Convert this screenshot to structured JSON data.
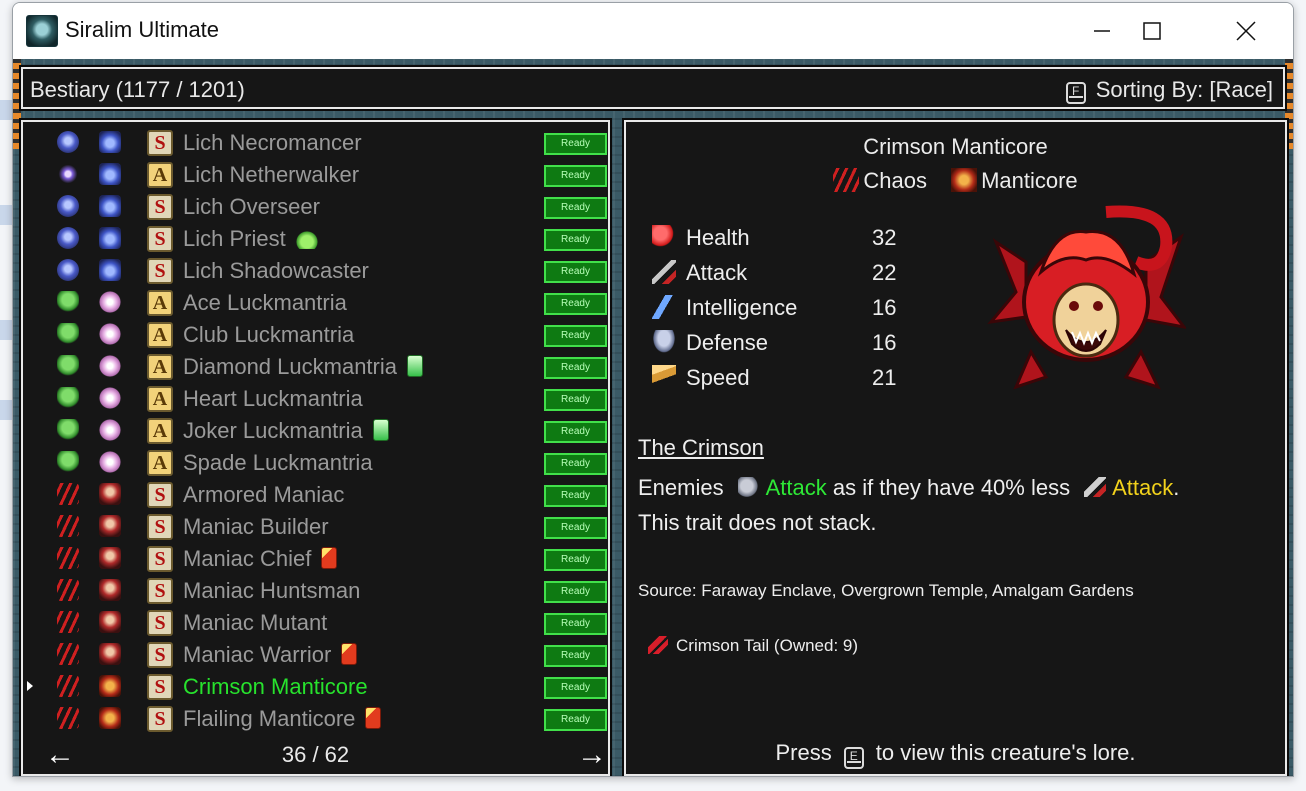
{
  "window": {
    "title": "Siralim Ultimate",
    "controls": [
      "minimize",
      "maximize",
      "close"
    ]
  },
  "header": {
    "title": "Bestiary (1177 / 1201)",
    "sort_key": "F",
    "sort_label": "Sorting By: [Race]"
  },
  "list": {
    "rows": [
      {
        "race": "lich",
        "family": "lich",
        "kind": "S",
        "name": "Lich Necromancer",
        "badge": "",
        "status": "Ready"
      },
      {
        "race": "spark",
        "family": "lich",
        "kind": "A",
        "name": "Lich Netherwalker",
        "badge": "",
        "status": "Ready"
      },
      {
        "race": "lich",
        "family": "lich",
        "kind": "S",
        "name": "Lich Overseer",
        "badge": "",
        "status": "Ready"
      },
      {
        "race": "lich",
        "family": "lich",
        "kind": "S",
        "name": "Lich Priest",
        "badge": "slime",
        "status": "Ready"
      },
      {
        "race": "lich",
        "family": "lich",
        "kind": "S",
        "name": "Lich Shadowcaster",
        "badge": "",
        "status": "Ready"
      },
      {
        "race": "tree",
        "family": "mantria",
        "kind": "A",
        "name": "Ace Luckmantria",
        "badge": "",
        "status": "Ready"
      },
      {
        "race": "tree",
        "family": "mantria",
        "kind": "A",
        "name": "Club Luckmantria",
        "badge": "",
        "status": "Ready"
      },
      {
        "race": "tree",
        "family": "mantria",
        "kind": "A",
        "name": "Diamond Luckmantria",
        "badge": "gem",
        "status": "Ready"
      },
      {
        "race": "tree",
        "family": "mantria",
        "kind": "A",
        "name": "Heart Luckmantria",
        "badge": "",
        "status": "Ready"
      },
      {
        "race": "tree",
        "family": "mantria",
        "kind": "A",
        "name": "Joker Luckmantria",
        "badge": "gem",
        "status": "Ready"
      },
      {
        "race": "tree",
        "family": "mantria",
        "kind": "A",
        "name": "Spade Luckmantria",
        "badge": "",
        "status": "Ready"
      },
      {
        "race": "chaos",
        "family": "maniac",
        "kind": "S",
        "name": "Armored Maniac",
        "badge": "",
        "status": "Ready"
      },
      {
        "race": "chaos",
        "family": "maniac",
        "kind": "S",
        "name": "Maniac Builder",
        "badge": "",
        "status": "Ready"
      },
      {
        "race": "chaos",
        "family": "maniac",
        "kind": "S",
        "name": "Maniac Chief",
        "badge": "card",
        "status": "Ready"
      },
      {
        "race": "chaos",
        "family": "maniac",
        "kind": "S",
        "name": "Maniac Huntsman",
        "badge": "",
        "status": "Ready"
      },
      {
        "race": "chaos",
        "family": "maniac",
        "kind": "S",
        "name": "Maniac Mutant",
        "badge": "",
        "status": "Ready"
      },
      {
        "race": "chaos",
        "family": "maniac",
        "kind": "S",
        "name": "Maniac Warrior",
        "badge": "card",
        "status": "Ready"
      },
      {
        "race": "chaos",
        "family": "manticore",
        "kind": "S",
        "name": "Crimson Manticore",
        "badge": "",
        "status": "Ready",
        "selected": true
      },
      {
        "race": "chaos",
        "family": "manticore",
        "kind": "S",
        "name": "Flailing Manticore",
        "badge": "card",
        "status": "Ready"
      }
    ],
    "pager": {
      "prev": "←",
      "next": "→",
      "page": "36 / 62"
    }
  },
  "detail": {
    "name": "Crimson Manticore",
    "class_label": "Chaos",
    "race_label": "Manticore",
    "stats": [
      {
        "icon": "heart-icon",
        "name": "Health",
        "value": "32"
      },
      {
        "icon": "sword-icon",
        "name": "Attack",
        "value": "22"
      },
      {
        "icon": "lightning-icon",
        "name": "Intelligence",
        "value": "16"
      },
      {
        "icon": "shield-icon",
        "name": "Defense",
        "value": "16"
      },
      {
        "icon": "wing-icon",
        "name": "Speed",
        "value": "21"
      }
    ],
    "trait": {
      "title": "The Crimson",
      "part1": "Enemies",
      "kw1": "Attack",
      "part2": " as if they have 40% less",
      "kw2": "Attack",
      "part3": ".",
      "line2": "This trait does not stack."
    },
    "source": "Source: Faraway Enclave, Overgrown Temple, Amalgam Gardens",
    "material": "Crimson Tail (Owned: 9)",
    "lore": {
      "pre": "Press",
      "key": "E",
      "post": "to view this creature's lore."
    }
  },
  "colors": {
    "selected": "#27e22d",
    "ready_bg": "#0e7a12",
    "keyword_green": "#2ee836",
    "keyword_yellow": "#f2d21c"
  }
}
